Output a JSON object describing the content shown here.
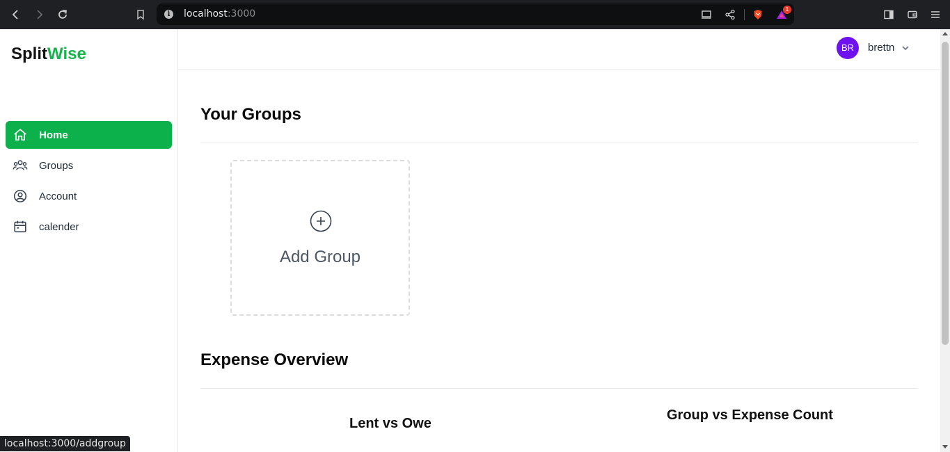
{
  "browser": {
    "url_host": "localhost",
    "url_port": ":3000",
    "shield_badge": "1",
    "status_url": "localhost:3000/addgroup"
  },
  "app": {
    "logo_part1": "Split",
    "logo_part2": "Wise",
    "accent_color": "#0db14b"
  },
  "sidebar": {
    "items": [
      {
        "label": "Home",
        "icon": "home-icon",
        "active": true
      },
      {
        "label": "Groups",
        "icon": "users-icon",
        "active": false
      },
      {
        "label": "Account",
        "icon": "user-circle-icon",
        "active": false
      },
      {
        "label": "calender",
        "icon": "calendar-icon",
        "active": false
      }
    ]
  },
  "header": {
    "avatar_initials": "BR",
    "username": "brettn"
  },
  "main": {
    "groups_title": "Your Groups",
    "add_group_label": "Add Group",
    "overview_title": "Expense Overview",
    "chart1_title": "Lent vs Owe",
    "chart2_title": "Group vs Expense Count"
  }
}
